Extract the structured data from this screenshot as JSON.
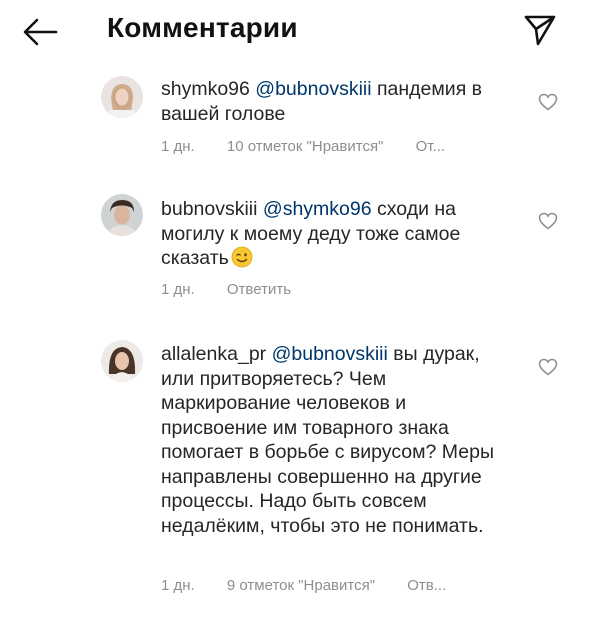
{
  "header": {
    "title": "Комментарии",
    "back_icon": "arrow-left-icon",
    "send_icon": "send-paper-plane-icon"
  },
  "comments": [
    {
      "username": "shymko96",
      "mention": "@bubnovskiii",
      "body": "пандемия в вашей голове",
      "time": "1 дн.",
      "likes": "10 отметок \"Нравится\"",
      "reply": "От..."
    },
    {
      "username": "bubnovskiii",
      "mention": "@shymko96",
      "body": "сходи на могилу к моему деду тоже самое сказать",
      "emoji": "winking-face-emoji",
      "time": "1 дн.",
      "reply": "Ответить"
    },
    {
      "username": "allalenka_pr",
      "mention": "@bubnovskiii",
      "body": "вы дурак, или притворяетесь? Чем маркирование человеков и присвоение им товарного знака помогает в борьбе с вирусом? Меры направлены совершенно на другие процессы. Надо быть совсем недалёким, чтобы это не понимать.",
      "time": "1 дн.",
      "likes": "9 отметок \"Нравится\"",
      "reply": "Отв..."
    }
  ],
  "colors": {
    "mention": "#00376b",
    "meta": "#8e8e8e",
    "text": "#262626"
  }
}
